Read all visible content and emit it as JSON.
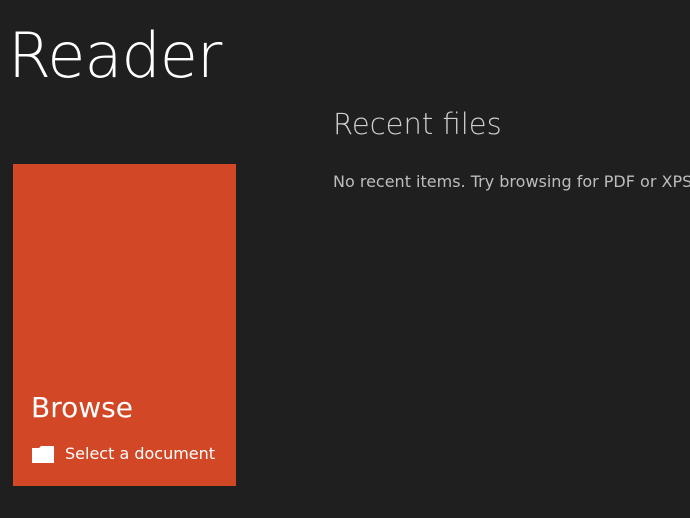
{
  "app": {
    "title": "Reader"
  },
  "browse_tile": {
    "title": "Browse",
    "subtitle": "Select a document",
    "icon": "folder-icon",
    "color": "#d24726"
  },
  "recent": {
    "title": "Recent files",
    "empty_message": "No recent items. Try browsing for PDF or XPS"
  }
}
